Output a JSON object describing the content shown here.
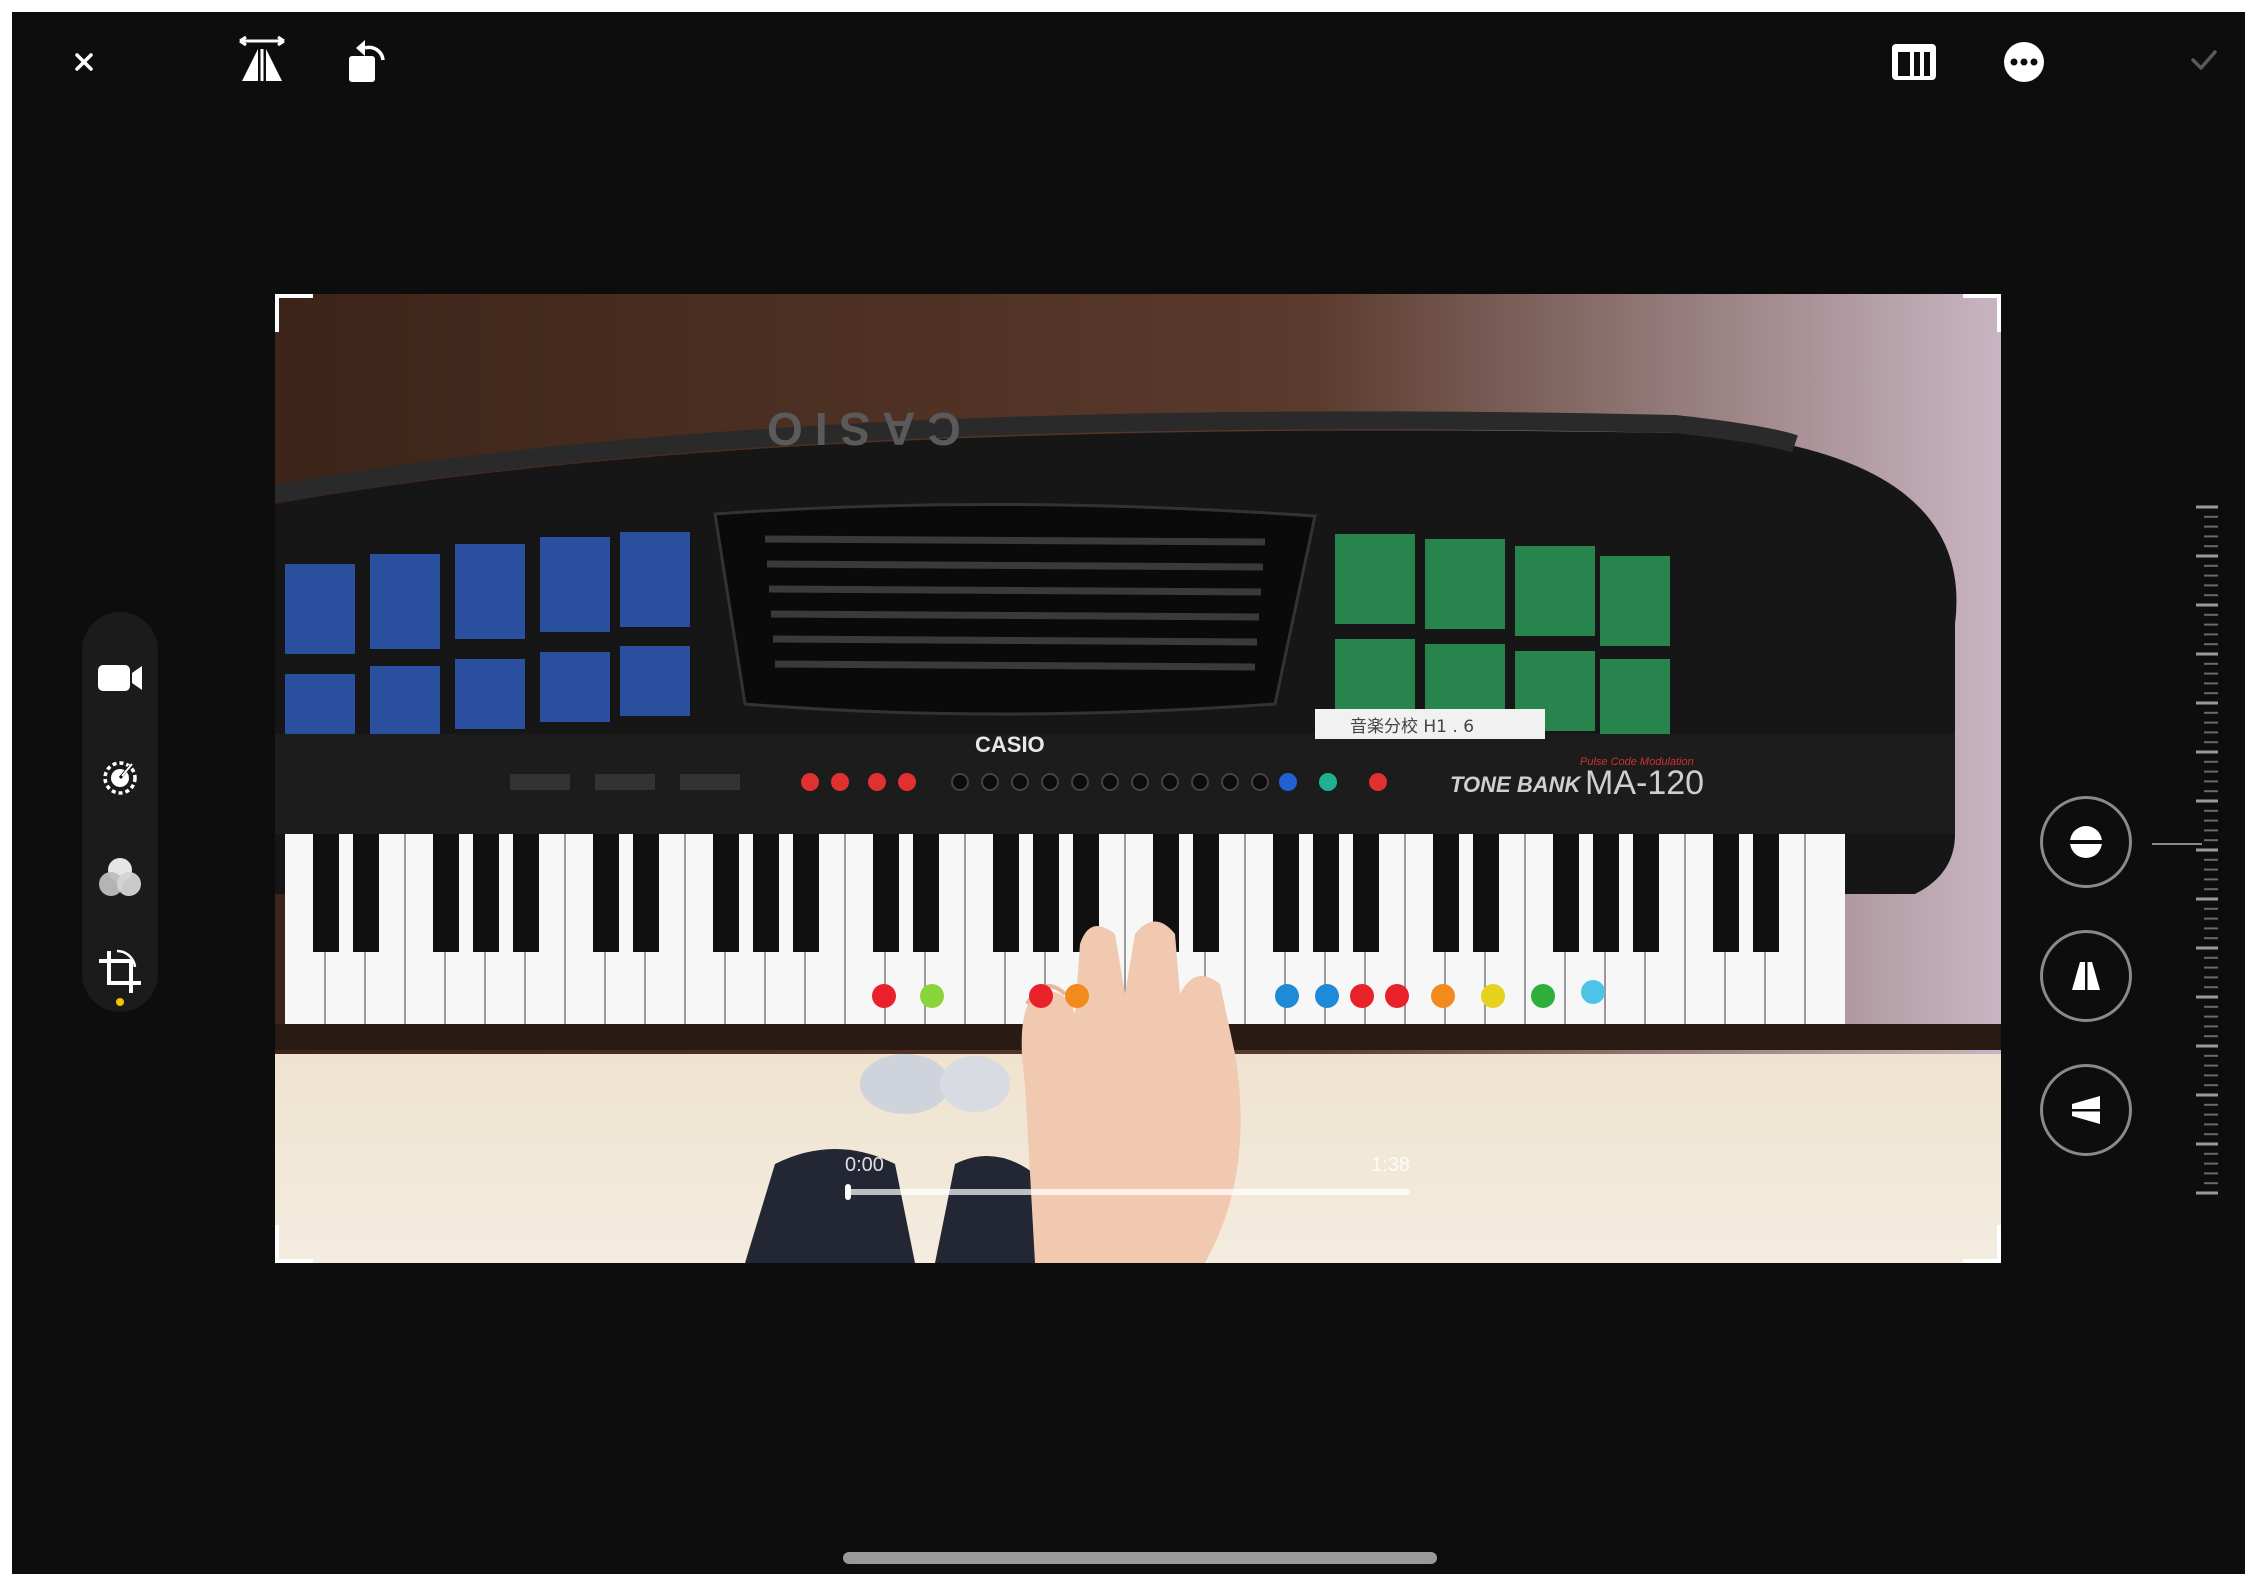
{
  "toolbar": {
    "close_icon": "close-icon",
    "flip_icon": "flip-horizontal-icon",
    "rotate_icon": "rotate-icon",
    "aspect_icon": "aspect-ratio-icon",
    "more_icon": "more-icon",
    "done_icon": "checkmark-icon"
  },
  "sidebar": {
    "tools": [
      {
        "name": "video",
        "icon": "video-camera-icon"
      },
      {
        "name": "adjust",
        "icon": "adjust-dial-icon"
      },
      {
        "name": "filters",
        "icon": "filters-icon"
      },
      {
        "name": "crop",
        "icon": "crop-rotate-icon",
        "active": true
      }
    ],
    "active_dot_color": "#f5c400"
  },
  "media": {
    "keyboard_brand": "CASIO",
    "keyboard_brand_mirrored": "CASIO",
    "keyboard_model": "MA-120",
    "keyboard_series": "TONE BANK",
    "keyboard_tagline": "Pulse Code Modulation",
    "tape_label": "音楽分校 H1 . 6",
    "sticker_colors": [
      "#e8212a",
      "#8ad43a",
      "#e8212a",
      "#f28a1e",
      "#1f8bd8",
      "#1f8bd8",
      "#e8212a",
      "#e8212a",
      "#f28a1e",
      "#e7d11f",
      "#2fae3b",
      "#4dc3e8"
    ]
  },
  "scrubber": {
    "current_time": "0:00",
    "end_time": "1:38"
  },
  "adjust_buttons": [
    {
      "name": "straighten",
      "icon": "straighten-icon"
    },
    {
      "name": "vertical",
      "icon": "vertical-perspective-icon"
    },
    {
      "name": "horizontal",
      "icon": "horizontal-perspective-icon"
    }
  ],
  "colors": {
    "background": "#0d0d0d",
    "accent_yellow": "#f5c400"
  }
}
